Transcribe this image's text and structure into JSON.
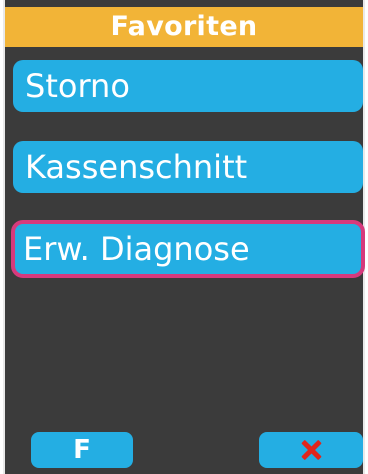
{
  "header": {
    "title": "Favoriten"
  },
  "menu": {
    "items": [
      {
        "label": "Storno"
      },
      {
        "label": "Kassenschnitt"
      },
      {
        "label": "Erw. Diagnose",
        "selected": true
      }
    ]
  },
  "footer": {
    "left_label": "F",
    "right_icon": "close-icon"
  },
  "colors": {
    "header_bg": "#f2b437",
    "button_bg": "#24aee3",
    "selection_border": "#d63a7c",
    "screen_bg": "#3b3b3b",
    "close_icon": "#e1251b"
  }
}
